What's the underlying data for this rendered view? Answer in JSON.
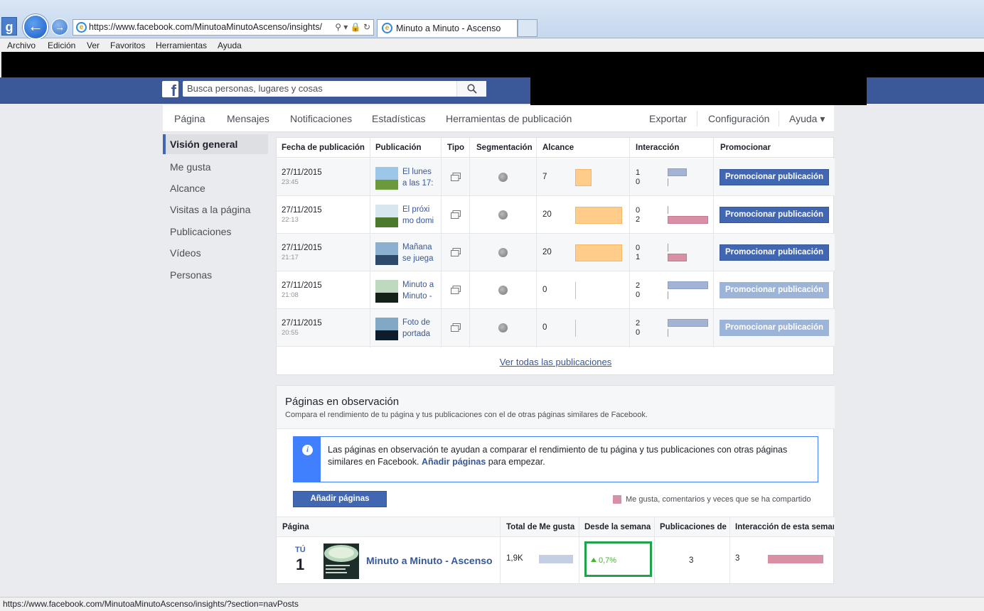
{
  "browser": {
    "address": "https://www.facebook.com/MinutoaMinutoAscenso/insights/",
    "tab_title": "Minuto a Minuto - Ascenso",
    "g_label": "g",
    "menu": [
      "Archivo",
      "Edición",
      "Ver",
      "Favoritos",
      "Herramientas",
      "Ayuda"
    ],
    "status_url": "https://www.facebook.com/MinutoaMinutoAscenso/insights/?section=navPosts"
  },
  "fb": {
    "logo": "f",
    "search_placeholder": "Busca personas, lugares y cosas"
  },
  "page_nav": {
    "left": [
      "Página",
      "Mensajes",
      "Notificaciones",
      "Estadísticas",
      "Herramientas de publicación"
    ],
    "right": [
      "Exportar",
      "Configuración",
      "Ayuda ▾"
    ]
  },
  "left_nav": [
    "Visión general",
    "Me gusta",
    "Alcance",
    "Visitas a la página",
    "Publicaciones",
    "Vídeos",
    "Personas"
  ],
  "posts": {
    "headers": [
      "Fecha de publicación",
      "Publicación",
      "Tipo",
      "Segmentación",
      "Alcance",
      "Interacción",
      "Promocionar"
    ],
    "rows": [
      {
        "date": "27/11/2015",
        "time": "23:45",
        "title": "El lunes a las 17:",
        "reach": "7",
        "reach_fraction": 0.35,
        "int_a": "1",
        "int_b": "0",
        "int_a_fraction": 0.48,
        "int_b_fraction": 0,
        "button": "Promocionar publicación",
        "enabled": true
      },
      {
        "date": "27/11/2015",
        "time": "22:13",
        "title": "El próxi mo domi",
        "reach": "20",
        "reach_fraction": 1.0,
        "int_a": "0",
        "int_b": "2",
        "int_a_fraction": 0,
        "int_b_fraction": 1.0,
        "button": "Promocionar publicación",
        "enabled": true
      },
      {
        "date": "27/11/2015",
        "time": "21:17",
        "title": "Mañana se juega",
        "reach": "20",
        "reach_fraction": 1.0,
        "int_a": "0",
        "int_b": "1",
        "int_a_fraction": 0,
        "int_b_fraction": 0.48,
        "button": "Promocionar publicación",
        "enabled": true
      },
      {
        "date": "27/11/2015",
        "time": "21:08",
        "title": "Minuto a Minuto -",
        "reach": "0",
        "reach_fraction": 0,
        "int_a": "2",
        "int_b": "0",
        "int_a_fraction": 1.0,
        "int_b_fraction": 0,
        "button": "Promocionar publicación",
        "enabled": false
      },
      {
        "date": "27/11/2015",
        "time": "20:55",
        "title": "Foto de portada",
        "reach": "0",
        "reach_fraction": 0,
        "int_a": "2",
        "int_b": "0",
        "int_a_fraction": 1.0,
        "int_b_fraction": 0,
        "button": "Promocionar publicación",
        "enabled": false
      }
    ],
    "see_all": "Ver todas las publicaciones"
  },
  "observed": {
    "title": "Páginas en observación",
    "subtitle": "Compara el rendimiento de tu página y tus publicaciones con el de otras páginas similares de Facebook.",
    "info_text": "Las páginas en observación te ayudan a comparar el rendimiento de tu página y tus publicaciones con otras páginas similares en Facebook.",
    "info_link": "Añadir páginas",
    "info_suffix": "para empezar.",
    "info_icon": "i",
    "add_button": "Añadir páginas",
    "legend": "Me gusta, comentarios y veces que se ha compartido",
    "headers": [
      "Página",
      "Total de Me gusta",
      "Desde la semana",
      "Publicaciones de",
      "Interacción de esta semar"
    ],
    "row": {
      "you": "TÚ",
      "rank": "1",
      "name": "Minuto a Minuto - Ascenso",
      "likes": "1,9K",
      "growth": "0,7%",
      "posts": "3",
      "interaction": "3"
    }
  },
  "colors": {
    "fb_blue": "#3b5998",
    "button_blue": "#4267b2",
    "reach_bar": "#ffcc8a",
    "likes_bar": "#a2b3d6",
    "interaction_bar": "#d98fa4",
    "highlight_green": "#1fa34a"
  }
}
